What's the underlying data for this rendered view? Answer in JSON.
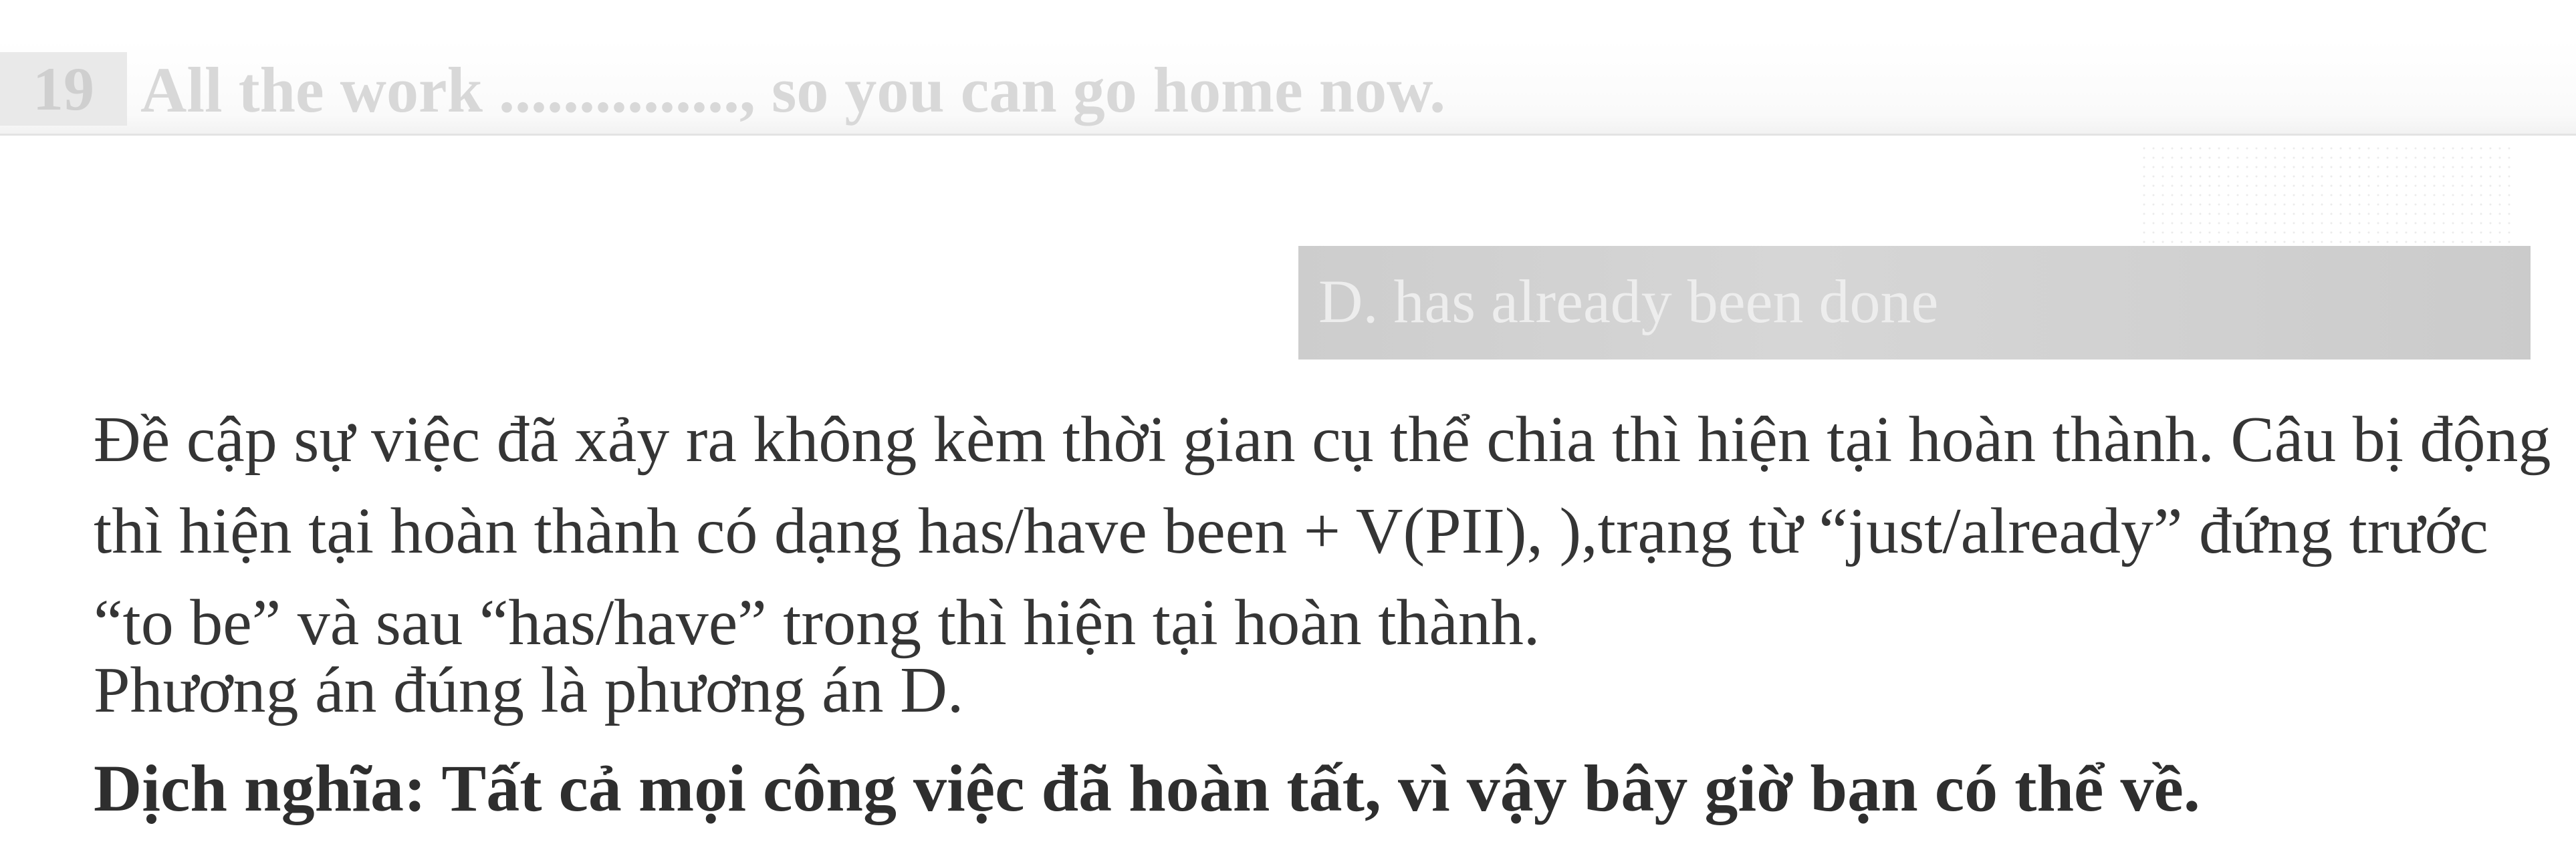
{
  "question": {
    "number": "19",
    "text": "All the work ..............., so you can go home now."
  },
  "answer": {
    "label": "D. has already been done"
  },
  "explanation": {
    "paragraph": "Đề cập sự việc đã xảy ra không kèm thời gian cụ thể chia thì hiện tại hoàn thành. Câu bị động thì hiện tại hoàn thành có dạng has/have been + V(PII), ),trạng từ “just/already” đứng trước “to be” và sau “has/have” trong thì hiện tại hoàn thành.",
    "conclusion": "Phương án đúng là phương án D.",
    "translation": "Dịch nghĩa: Tất cả mọi công việc đã hoàn tất, vì vậy bây giờ bạn có thể về."
  },
  "colors": {
    "body_text": "#353535",
    "faded_question": "#d8d8d8",
    "answer_box": "#d1d1d1"
  }
}
